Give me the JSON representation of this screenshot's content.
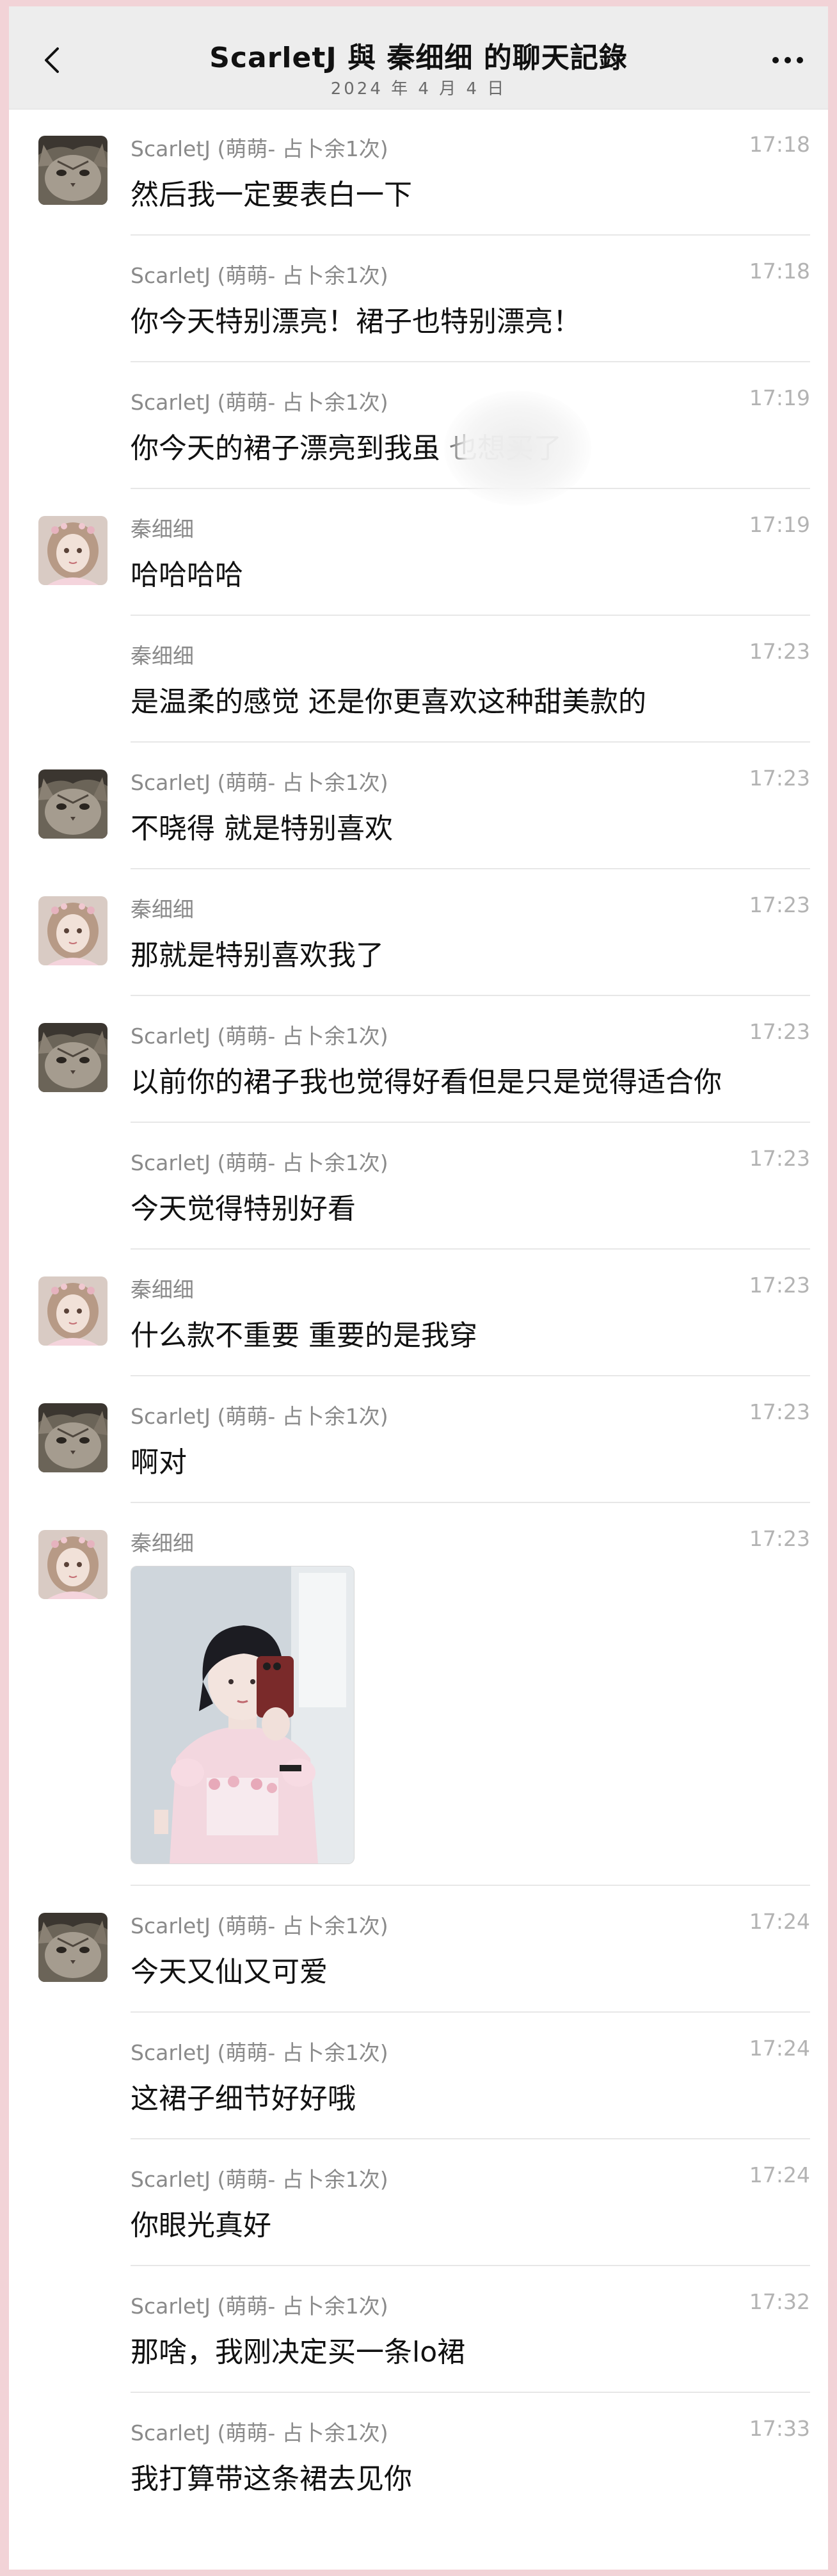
{
  "header": {
    "title": "ScarletJ 與 秦细细 的聊天記錄",
    "date": "2024 年 4 月 4 日",
    "back_icon": "chevron-left-icon",
    "more_icon": "more-horizontal-icon"
  },
  "messages": [
    {
      "sender": "ScarletJ (萌萌- 占卜余1次)",
      "time": "17:18",
      "text": "然后我一定要表白一下",
      "avatar": "cat"
    },
    {
      "sender": "ScarletJ (萌萌- 占卜余1次)",
      "time": "17:18",
      "text": "你今天特别漂亮！裙子也特别漂亮！",
      "avatar": ""
    },
    {
      "sender": "ScarletJ (萌萌- 占卜余1次)",
      "time": "17:19",
      "text": "你今天的裙子漂亮到我虽                  也想买了",
      "avatar": ""
    },
    {
      "sender": "秦细细",
      "time": "17:19",
      "text": "哈哈哈哈",
      "avatar": "girl"
    },
    {
      "sender": "秦细细",
      "time": "17:23",
      "text": "是温柔的感觉 还是你更喜欢这种甜美款的",
      "avatar": ""
    },
    {
      "sender": "ScarletJ (萌萌- 占卜余1次)",
      "time": "17:23",
      "text": "不晓得 就是特别喜欢",
      "avatar": "cat"
    },
    {
      "sender": "秦细细",
      "time": "17:23",
      "text": "那就是特别喜欢我了",
      "avatar": "girl"
    },
    {
      "sender": "ScarletJ (萌萌- 占卜余1次)",
      "time": "17:23",
      "text": "以前你的裙子我也觉得好看但是只是觉得适合你",
      "avatar": "cat"
    },
    {
      "sender": "ScarletJ (萌萌- 占卜余1次)",
      "time": "17:23",
      "text": "今天觉得特别好看",
      "avatar": ""
    },
    {
      "sender": "秦细细",
      "time": "17:23",
      "text": "什么款不重要 重要的是我穿",
      "avatar": "girl"
    },
    {
      "sender": "ScarletJ (萌萌- 占卜余1次)",
      "time": "17:23",
      "text": "啊对",
      "avatar": "cat"
    },
    {
      "sender": "秦细细",
      "time": "17:23",
      "text": "",
      "avatar": "girl",
      "image": "photo-selfie"
    },
    {
      "sender": "ScarletJ (萌萌- 占卜余1次)",
      "time": "17:24",
      "text": "今天又仙又可爱",
      "avatar": "cat"
    },
    {
      "sender": "ScarletJ (萌萌- 占卜余1次)",
      "time": "17:24",
      "text": "这裙子细节好好哦",
      "avatar": ""
    },
    {
      "sender": "ScarletJ (萌萌- 占卜余1次)",
      "time": "17:24",
      "text": "你眼光真好",
      "avatar": ""
    },
    {
      "sender": "ScarletJ (萌萌- 占卜余1次)",
      "time": "17:32",
      "text": "那啥，我刚决定买一条lo裙",
      "avatar": ""
    },
    {
      "sender": "ScarletJ (萌萌- 占卜余1次)",
      "time": "17:33",
      "text": "我打算带这条裙去见你",
      "avatar": ""
    }
  ],
  "colors": {
    "page_border": "#f2d3d7",
    "header_bg": "#ededed",
    "sender": "#8a8a8a",
    "time": "#b3b3b3"
  }
}
